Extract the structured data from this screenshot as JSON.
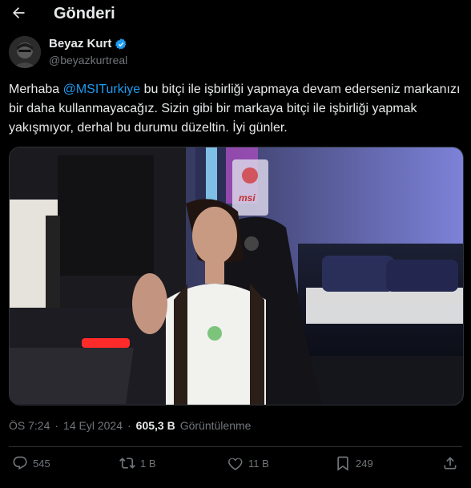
{
  "header": {
    "title": "Gönderi"
  },
  "author": {
    "name": "Beyaz Kurt",
    "handle": "@beyazkurtreal",
    "verified": true
  },
  "tweet": {
    "text_before": "Merhaba ",
    "mention": "@MSITurkiye",
    "text_after": " bu bitçi ile işbirliği yapmaya devam ederseniz markanızı bir daha kullanmayacağız. Sizin gibi bir markaya bitçi ile işbirliği yapmak yakışmıyor, derhal bu durumu düzeltin. İyi günler.",
    "media_logo_text": "msi"
  },
  "meta": {
    "time": "ÖS 7:24",
    "separator": "·",
    "date": "14 Eyl 2024",
    "views_count": "605,3 B",
    "views_label": "Görüntülenme"
  },
  "actions": {
    "replies": "545",
    "retweets": "1 B",
    "likes": "11 B",
    "bookmarks": "249"
  },
  "colors": {
    "accent": "#1d9bf0",
    "background": "#000000",
    "muted": "#71767b",
    "text": "#e7e9ea"
  }
}
